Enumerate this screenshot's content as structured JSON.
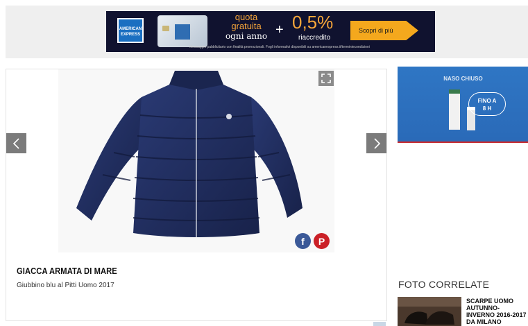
{
  "top_ad": {
    "brand": "AMERICAN EXPRESS",
    "headline_line1": "quota",
    "headline_line2": "gratuita",
    "headline_line3": "ogni anno",
    "plus": "+",
    "rate": "0,5%",
    "rate_label": "riaccredito",
    "cta_label": "Scopri di più",
    "disclaimer": "Messaggio pubblicitario con finalità promozionali. Fogli informativi disponibili su americanexpress.it/terminiecondizioni",
    "colors": {
      "accent": "#f7a63a",
      "background": "#10122f",
      "cta": "#f4a81d"
    }
  },
  "gallery": {
    "product_title": "GIACCA ARMATA DI MARE",
    "product_subtitle": "Giubbino blu al Pitti Uomo 2017",
    "prev_icon": "chevron-left-icon",
    "next_icon": "chevron-right-icon",
    "expand_icon": "fullscreen-icon",
    "share": {
      "facebook_glyph": "f",
      "pinterest_glyph": "P"
    },
    "colors": {
      "jacket": "#1e2a5a",
      "nav": "#7b7b7b"
    }
  },
  "side_ad": {
    "headline": "NASO CHIUSO",
    "badge_line1": "FINO A",
    "badge_line2": "8 H",
    "colors": {
      "background": "#2f76c4"
    }
  },
  "related": {
    "heading": "FOTO CORRELATE",
    "items": [
      {
        "title": "SCARPE UOMO AUTUNNO-INVERNO 2016-2017 DA MILANO"
      }
    ]
  }
}
